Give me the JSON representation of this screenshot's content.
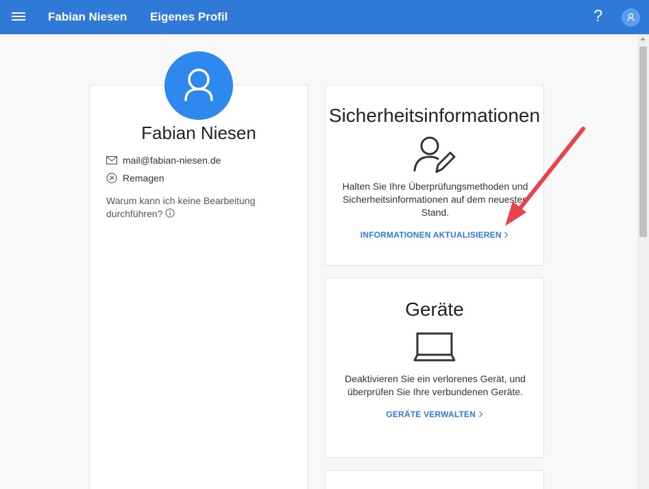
{
  "topbar": {
    "user_name": "Fabian Niesen",
    "page_title": "Eigenes Profil",
    "help_label": "?"
  },
  "profile": {
    "name": "Fabian Niesen",
    "email": "mail@fabian-niesen.de",
    "location": "Remagen",
    "why_no_edit": "Warum kann ich keine Bearbeitung durchführen?"
  },
  "security": {
    "title": "Sicherheitsinformationen",
    "description": "Halten Sie Ihre Überprüfungsmethoden und Sicherheitsinformationen auf dem neuesten Stand.",
    "link": "INFORMATIONEN AKTUALISIEREN"
  },
  "devices": {
    "title": "Geräte",
    "description": "Deaktivieren Sie ein verlorenes Gerät, und überprüfen Sie Ihre verbundenen Geräte.",
    "link": "GERÄTE VERWALTEN"
  },
  "colors": {
    "topbar": "#2f7ad6",
    "avatar": "#2f88ee",
    "link": "#2f7ad6",
    "annotation_arrow": "#e8424a"
  },
  "icons": {
    "menu": "hamburger-icon",
    "help": "help-icon",
    "account": "user-icon",
    "mail": "mail-icon",
    "location": "location-icon",
    "info": "info-icon",
    "security": "user-edit-icon",
    "devices": "laptop-icon"
  }
}
